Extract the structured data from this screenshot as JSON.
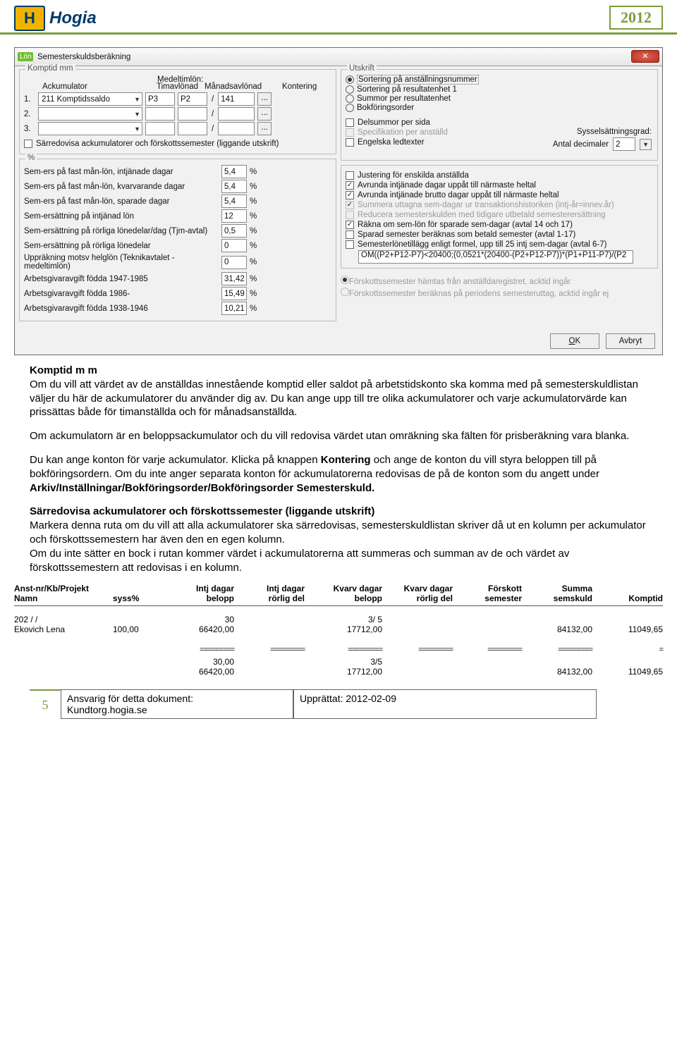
{
  "header": {
    "logo_text": "Hogia",
    "year": "2012"
  },
  "dialog": {
    "title": "Semesterskuldsberäkning",
    "komptid": {
      "group": "Komptid mm",
      "ack_label": "Ackumulator",
      "medel_label": "Medeltimlön:",
      "tim_label": "Timavlönad",
      "man_label": "Månadsavlönad",
      "kont_label": "Kontering",
      "rows": [
        {
          "n": "1.",
          "ack": "211 Komptidssaldo",
          "tim": "P3",
          "man": "P2",
          "kont": "141"
        },
        {
          "n": "2.",
          "ack": "",
          "tim": "",
          "man": "",
          "kont": ""
        },
        {
          "n": "3.",
          "ack": "",
          "tim": "",
          "man": "",
          "kont": ""
        }
      ],
      "sarred": "Särredovisa ackumulatorer och förskottssemester (liggande utskrift)"
    },
    "percent": {
      "group": "%",
      "rows": [
        {
          "lbl": "Sem-ers på fast mån-lön, intjänade dagar",
          "v": "5,4"
        },
        {
          "lbl": "Sem-ers på fast mån-lön, kvarvarande dagar",
          "v": "5,4"
        },
        {
          "lbl": "Sem-ers på fast mån-lön, sparade dagar",
          "v": "5,4"
        },
        {
          "lbl": "Sem-ersättning på intjänad lön",
          "v": "12"
        },
        {
          "lbl": "Sem-ersättning på rörliga lönedelar/dag (Tjm-avtal)",
          "v": "0,5"
        },
        {
          "lbl": "Sem-ersättning på rörliga lönedelar",
          "v": "0"
        },
        {
          "lbl": "Uppräkning motsv helglön (Teknikavtalet - medeltimlön)",
          "v": "0"
        },
        {
          "lbl": "Arbetsgivaravgift födda 1947-1985",
          "v": "31,42"
        },
        {
          "lbl": "Arbetsgivaravgift födda 1986-",
          "v": "15,49"
        },
        {
          "lbl": "Arbetsgivaravgift födda 1938-1946",
          "v": "10,21"
        }
      ]
    },
    "utskrift": {
      "group": "Utskrift",
      "radios": [
        "Sortering på anställningsnummer",
        "Sortering på resultatenhet 1",
        "Summor per resultatenhet",
        "Bokföringsorder"
      ],
      "delsummor": "Delsummor per sida",
      "spec": "Specifikation per anställd",
      "eng": "Engelska ledtexter",
      "syssel_label": "Sysselsättningsgrad:",
      "decimaler_label": "Antal decimaler",
      "decimaler": "2"
    },
    "options": {
      "o1": "Justering för enskilda anställda",
      "o2": "Avrunda intjänade dagar uppåt till närmaste heltal",
      "o3": "Avrunda intjänade brutto dagar uppåt till närmaste heltal",
      "o4": "Summera uttagna sem-dagar ur transaktionshistoriken (intj-år=innev.år)",
      "o5": "Reducera semesterskulden med tidigare utbetald semesterersättning",
      "o6": "Räkna om sem-lön för sparade sem-dagar (avtal 14 och 17)",
      "o7": "Sparad semester beräknas som betald semester (avtal 1-17)",
      "o8": "Semesterlönetillägg enligt formel, upp till 25 intj sem-dagar (avtal 6-7)",
      "formula": "OM((P2+P12-P7)<20400;(0,0521*(20400-(P2+P12-P7))*(P1+P11-P7)/(P2"
    },
    "forskott": {
      "r1": "Förskottssemester hämtas från anställdaregistret, acktid ingår",
      "r2": "Förskottssemester beräknas på periodens semesteruttag, acktid ingår ej"
    },
    "ok": "OK",
    "cancel": "Avbryt"
  },
  "article": {
    "h": "Komptid m m",
    "p1": "Om du vill att värdet av de anställdas innestående komptid eller saldot på arbetstidskonto ska komma med på semesterskuldlistan väljer du här de ackumulatorer du använder dig av. Du kan ange upp till tre olika ackumulatorer och varje ackumulatorvärde kan prissättas både för timanställda och för månadsanställda.",
    "p2": "Om ackumulatorn är en beloppsackumulator och du vill redovisa värdet utan omräkning ska fälten för prisberäkning vara blanka.",
    "p3a": "Du kan ange konton för varje ackumulator. Klicka på knappen ",
    "p3b": "Kontering",
    "p3c": " och ange de konton du vill styra beloppen till på bokföringsordern. Om du inte anger separata konton för ackumulatorerna redovisas de på de konton som du angett under ",
    "p3d": "Arkiv/Inställningar/Bokföringsorder/Bokföringsorder Semesterskuld.",
    "h2": "Särredovisa ackumulatorer och förskottssemester (liggande utskrift)",
    "p4": "Markera denna ruta om du vill att alla ackumulatorer ska särredovisas, semesterskuldlistan skriver då ut en kolumn per ackumulator och förskottssemestern har även den en egen kolumn.",
    "p5": "Om du inte sätter en bock i rutan kommer värdet i ackumulatorerna att summeras och summan av de och värdet av förskottssemestern att redovisas i en kolumn."
  },
  "report": {
    "head": {
      "c1a": "Anst-nr/Kb/Projekt",
      "c1b": "Namn",
      "c2": "syss%",
      "c3a": "Intj dagar",
      "c3b": "belopp",
      "c4a": "Intj dagar",
      "c4b": "rörlig del",
      "c5a": "Kvarv dagar",
      "c5b": "belopp",
      "c6a": "Kvarv dagar",
      "c6b": "rörlig del",
      "c7a": "Förskott",
      "c7b": "semester",
      "c8a": "Summa",
      "c8b": "semskuld",
      "c9": "Komptid"
    },
    "row": {
      "id": "202 / /",
      "name": "Ekovich Lena",
      "syss": "100,00",
      "intj_d": "30",
      "intj_b": "66420,00",
      "kvarv_d": "3/ 5",
      "kvarv_b": "17712,00",
      "forskott": "",
      "summa": "84132,00",
      "komptid": "11049,65"
    },
    "sum": {
      "intj_d": "30,00",
      "intj_b": "66420,00",
      "kvarv_d": "3/5",
      "kvarv_b": "17712,00",
      "summa": "84132,00",
      "komptid": "11049,65"
    }
  },
  "footer": {
    "page": "5",
    "resp_label": "Ansvarig för detta dokument:",
    "resp": "Kundtorg.hogia.se",
    "upp_label": "Upprättat:",
    "upp": "2012-02-09"
  }
}
